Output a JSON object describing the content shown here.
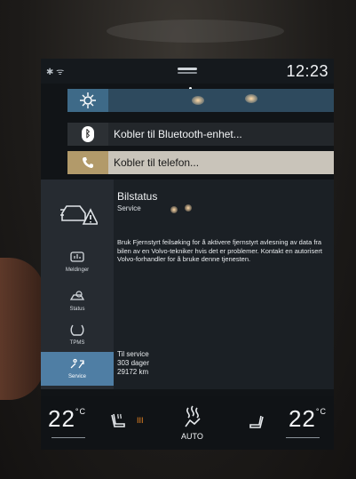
{
  "status_bar": {
    "clock": "12:23"
  },
  "notifications": {
    "bluetooth": {
      "label": "Kobler til Bluetooth-enhet..."
    },
    "phone": {
      "label": "Kobler til telefon..."
    }
  },
  "app": {
    "title": "Bilstatus",
    "subtitle": "Service",
    "body": "Bruk Fjernstyrt feilsøking for å aktivere fjernstyrt avlesning av data fra bilen av en Volvo-tekniker hvis det er problemer. Kontakt en autorisert Volvo-forhandler for å bruke denne tjenesten.",
    "service_label": "Til service",
    "service_days": "303 dager",
    "service_km": "29172 km"
  },
  "sidebar": {
    "items": [
      {
        "label": "Meldinger",
        "icon": "messages-icon"
      },
      {
        "label": "Status",
        "icon": "status-icon"
      },
      {
        "label": "TPMS",
        "icon": "tpms-icon"
      },
      {
        "label": "Service",
        "icon": "service-icon",
        "active": true
      }
    ]
  },
  "climate": {
    "left_temp": "22",
    "right_temp": "22",
    "unit": "°C",
    "fan_mode": "AUTO",
    "seat_heat_level": "III"
  },
  "colors": {
    "active_tab": "#4f7ea4",
    "phone_row": "#c9c4ba",
    "phone_icon_bg": "#b29a6a",
    "seat_heat": "#f08a24"
  }
}
